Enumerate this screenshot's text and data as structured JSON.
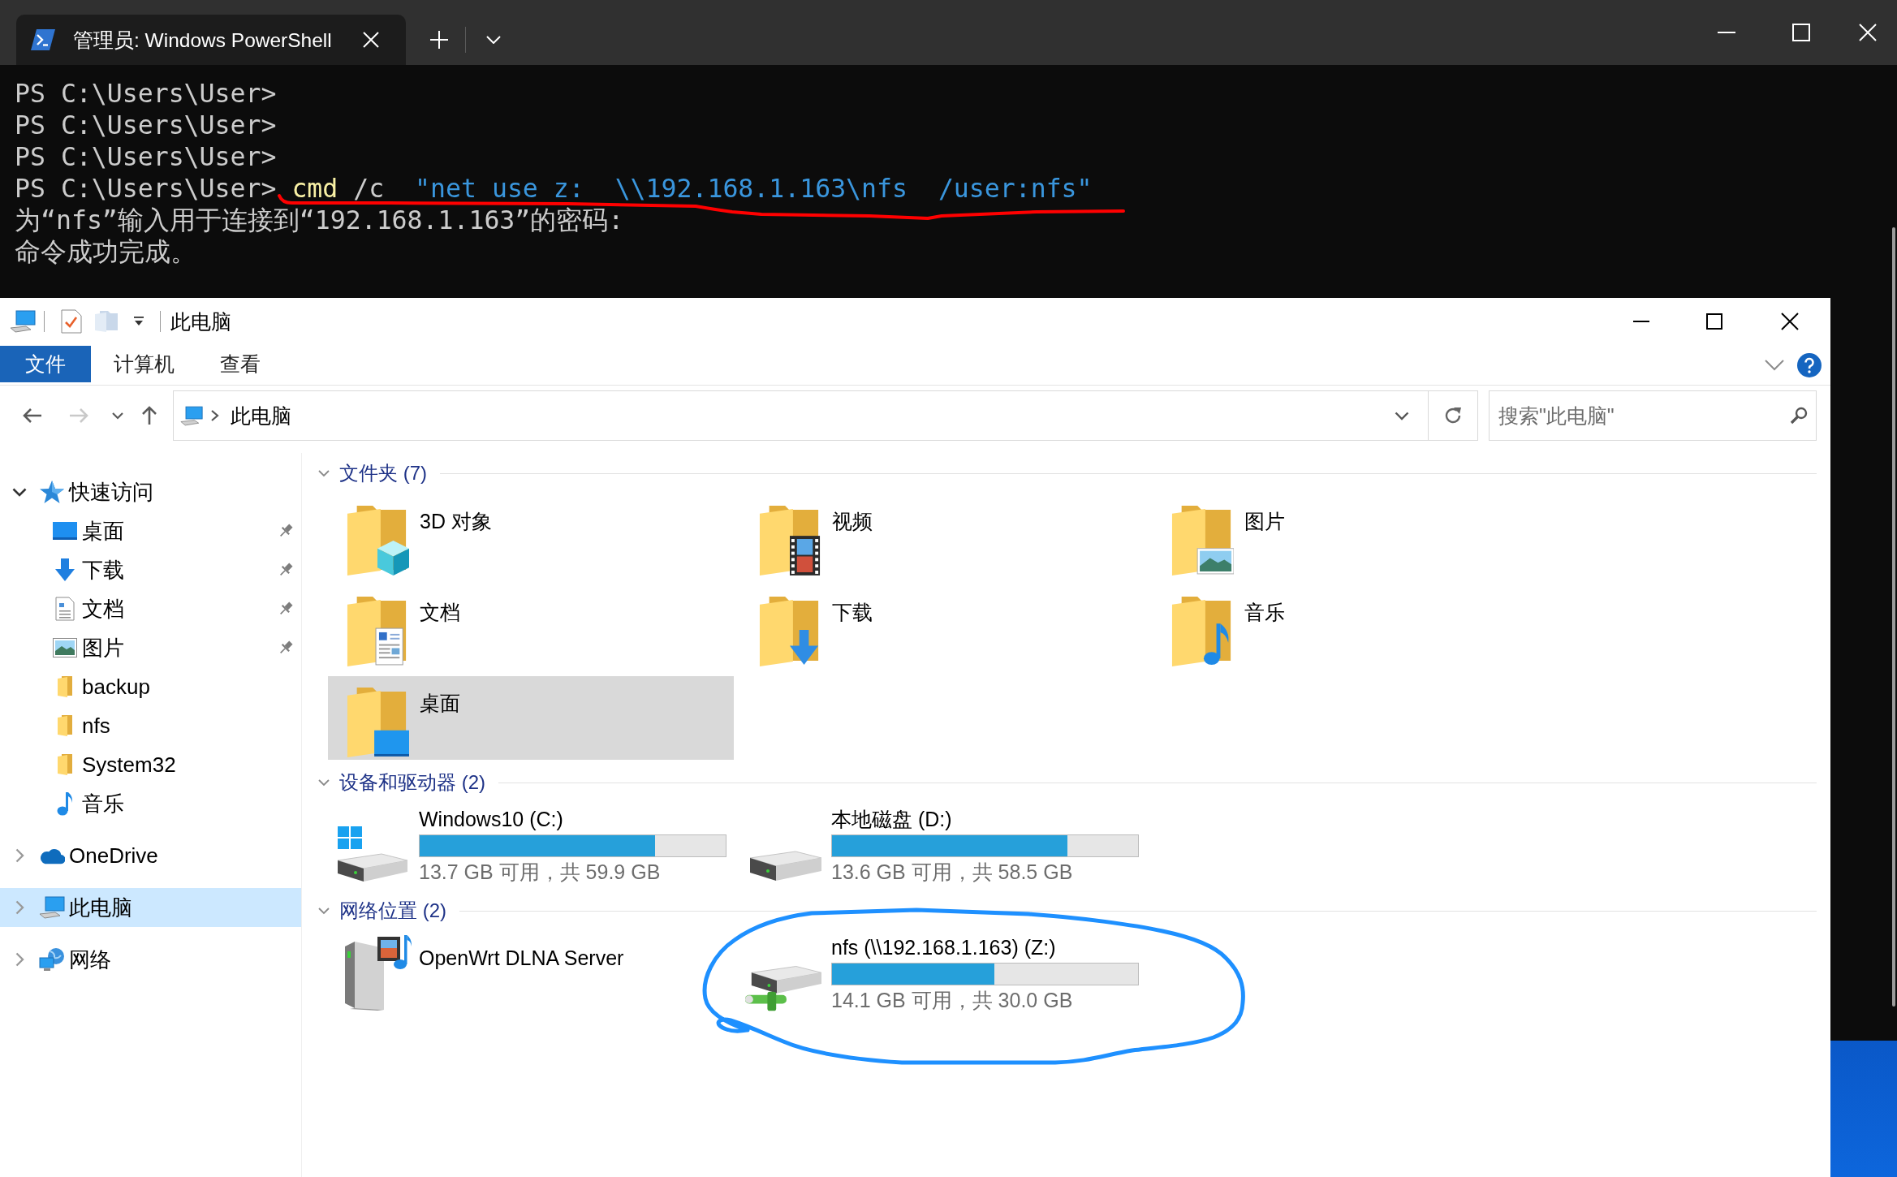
{
  "terminal": {
    "tab": {
      "title": "管理员: Windows PowerShell",
      "selected": true
    },
    "lines": [
      {
        "segments": [
          {
            "kind": "plain",
            "text": "PS C:\\Users\\User>"
          }
        ]
      },
      {
        "segments": [
          {
            "kind": "plain",
            "text": "PS C:\\Users\\User>"
          }
        ]
      },
      {
        "segments": [
          {
            "kind": "plain",
            "text": "PS C:\\Users\\User>"
          }
        ]
      },
      {
        "segments": [
          {
            "kind": "plain",
            "text": "PS C:\\Users\\User> "
          },
          {
            "kind": "command",
            "text": "cmd"
          },
          {
            "kind": "plain",
            "text": " /c  "
          },
          {
            "kind": "string",
            "text": "\"net use z:  \\\\192.168.1.163\\nfs  /user:nfs\""
          }
        ]
      },
      {
        "segments": [
          {
            "kind": "plain",
            "text": "为“nfs”输入用于连接到“192.168.1.163”的密码:"
          }
        ]
      },
      {
        "segments": [
          {
            "kind": "plain",
            "text": "命令成功完成。"
          }
        ]
      }
    ]
  },
  "explorer": {
    "title": "此电脑",
    "ribbon_tabs": [
      {
        "label": "文件",
        "kind": "file"
      },
      {
        "label": "计算机",
        "kind": "tab"
      },
      {
        "label": "查看",
        "kind": "tab"
      }
    ],
    "nav_buttons": [
      {
        "kind": "back",
        "disabled": false
      },
      {
        "kind": "forward",
        "disabled": true
      },
      {
        "kind": "recent",
        "disabled": false
      },
      {
        "kind": "up",
        "disabled": false
      }
    ],
    "address": {
      "path": [
        "此电脑"
      ]
    },
    "search": {
      "placeholder": "搜索\"此电脑\""
    },
    "sidebar": {
      "items": [
        {
          "label": "快速访问",
          "kind": "quick-access",
          "expanded": true,
          "selected": false,
          "children": [
            {
              "label": "桌面",
              "kind": "desktop",
              "pinned": true,
              "selected": false
            },
            {
              "label": "下载",
              "kind": "downloads",
              "pinned": true,
              "selected": false
            },
            {
              "label": "文档",
              "kind": "documents",
              "pinned": true,
              "selected": false
            },
            {
              "label": "图片",
              "kind": "pictures",
              "pinned": true,
              "selected": false
            },
            {
              "label": "backup",
              "kind": "folder",
              "pinned": false,
              "selected": false
            },
            {
              "label": "nfs",
              "kind": "folder",
              "pinned": false,
              "selected": false
            },
            {
              "label": "System32",
              "kind": "folder",
              "pinned": false,
              "selected": false
            },
            {
              "label": "音乐",
              "kind": "music",
              "pinned": false,
              "selected": false
            }
          ]
        },
        {
          "label": "OneDrive",
          "kind": "onedrive",
          "expanded": false,
          "selected": false
        },
        {
          "label": "此电脑",
          "kind": "computer",
          "expanded": false,
          "selected": true
        },
        {
          "label": "网络",
          "kind": "network",
          "expanded": false,
          "selected": false
        }
      ]
    },
    "groups": [
      {
        "title": "文件夹 (7)",
        "expanded": true,
        "items": [
          {
            "name": "3D 对象",
            "kind": "objects3d",
            "selected": false
          },
          {
            "name": "视频",
            "kind": "videos",
            "selected": false
          },
          {
            "name": "图片",
            "kind": "pictures",
            "selected": false
          },
          {
            "name": "文档",
            "kind": "documents",
            "selected": false
          },
          {
            "name": "下载",
            "kind": "downloads",
            "selected": false
          },
          {
            "name": "音乐",
            "kind": "music",
            "selected": false
          },
          {
            "name": "桌面",
            "kind": "desktop",
            "selected": true
          }
        ]
      },
      {
        "title": "设备和驱动器 (2)",
        "expanded": true,
        "items": [
          {
            "name": "Windows10 (C:)",
            "kind": "system-drive",
            "selected": false,
            "level": 0.77,
            "usage": "13.7 GB 可用，共 59.9 GB"
          },
          {
            "name": "本地磁盘 (D:)",
            "kind": "disk",
            "selected": false,
            "level": 0.77,
            "usage": "13.6 GB 可用，共 58.5 GB"
          }
        ]
      },
      {
        "title": "网络位置 (2)",
        "expanded": true,
        "items": [
          {
            "name": "OpenWrt DLNA Server",
            "kind": "media-server",
            "selected": false
          },
          {
            "name": "nfs (\\\\192.168.1.163) (Z:)",
            "kind": "network-drive",
            "selected": false,
            "level": 0.53,
            "usage": "14.1 GB 可用，共 30.0 GB"
          }
        ]
      }
    ]
  },
  "annotations": [
    {
      "kind": "underline",
      "color": "#ff0000"
    },
    {
      "kind": "loop",
      "color": "#1e90ff"
    }
  ]
}
